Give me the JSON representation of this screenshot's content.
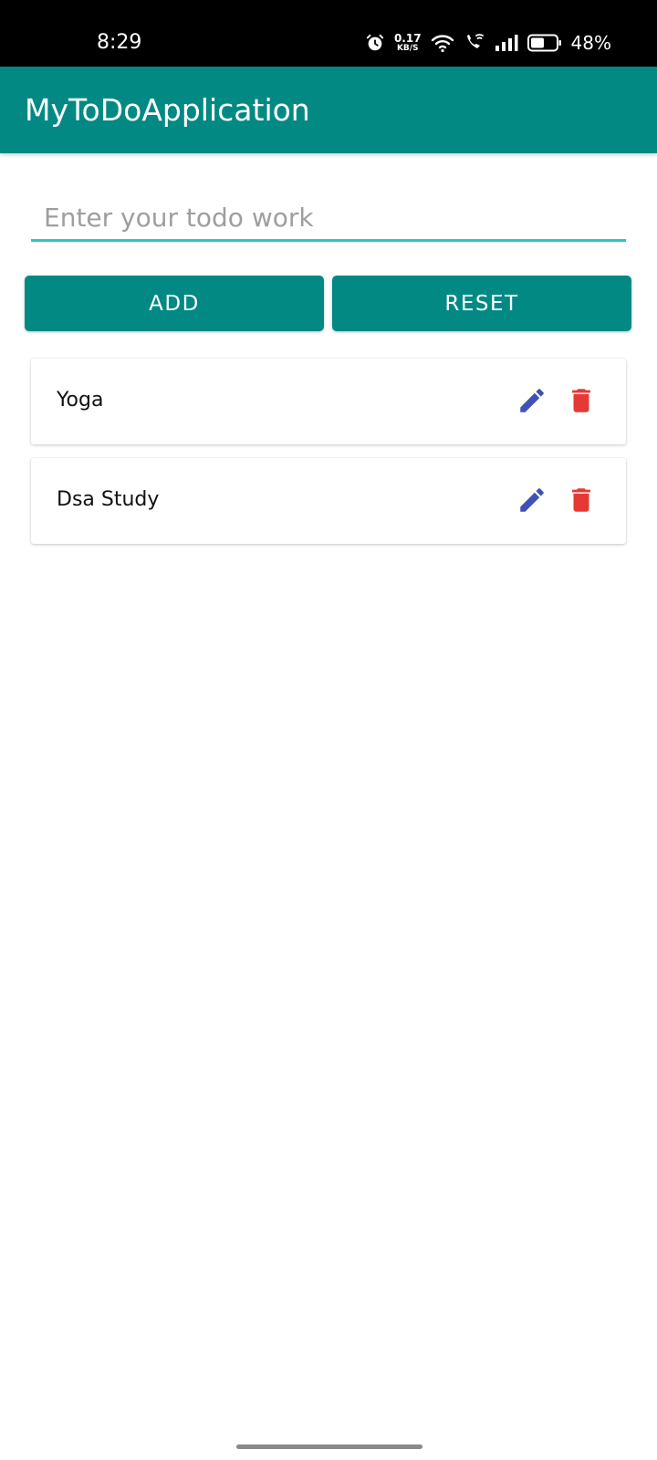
{
  "status_bar": {
    "time": "8:29",
    "net_speed_value": "0.17",
    "net_speed_unit": "KB/S",
    "battery_percent": "48%",
    "icons": [
      "alarm-icon",
      "wifi-icon",
      "wifi-call-icon",
      "signal-icon",
      "battery-icon"
    ]
  },
  "app_bar": {
    "title": "MyToDoApplication"
  },
  "input": {
    "placeholder": "Enter your todo work",
    "value": ""
  },
  "buttons": {
    "add_label": "ADD",
    "reset_label": "RESET"
  },
  "todos": [
    {
      "text": "Yoga"
    },
    {
      "text": "Dsa Study"
    }
  ],
  "colors": {
    "primary": "#028984",
    "input_underline": "#2ec5c0",
    "edit_icon": "#3f51b5",
    "delete_icon": "#e53935"
  }
}
